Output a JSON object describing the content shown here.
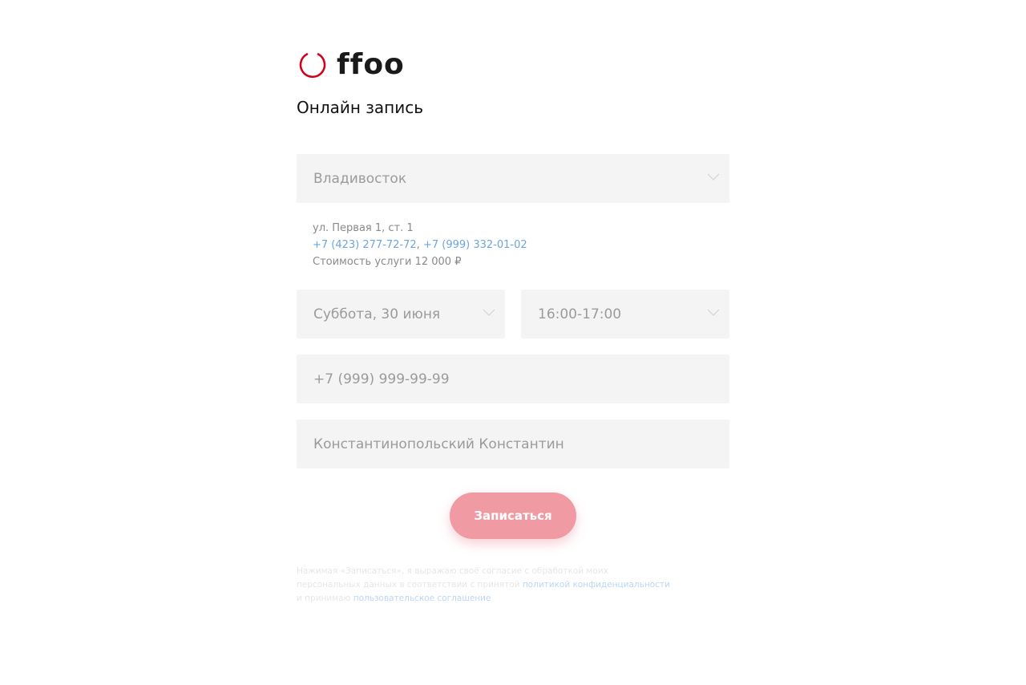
{
  "brand": {
    "name": "ffoo",
    "accent_color": "#d0021b"
  },
  "page": {
    "title": "Онлайн запись"
  },
  "form": {
    "city_value": "Владивосток",
    "info": {
      "address": "ул. Первая 1, ст. 1",
      "phone1": "+7 (423) 277-72-72",
      "separator": ",",
      "phone2": "+7 (999) 332-01-02",
      "price": "Стоимость услуги 12 000 ₽"
    },
    "date_value": "Суббота, 30 июня",
    "time_value": "16:00-17:00",
    "phone_placeholder": "+7 (999) 999-99-99",
    "name_placeholder": "Константинопольский Константин",
    "submit_label": "Записаться",
    "submit_color": "#f09aa4"
  },
  "consent": {
    "text_before": "Нажимая «Записаться», я выражаю своё согласие с обработкой моих персональных данных в соответствии с принятой ",
    "privacy_link": "политикой конфиденциальности",
    "text_middle": " и принимаю ",
    "agreement_link": "пользовательское соглашение"
  },
  "icons": {
    "logo": "ring-logo-icon",
    "dropdown": "chevron-down-icon"
  }
}
